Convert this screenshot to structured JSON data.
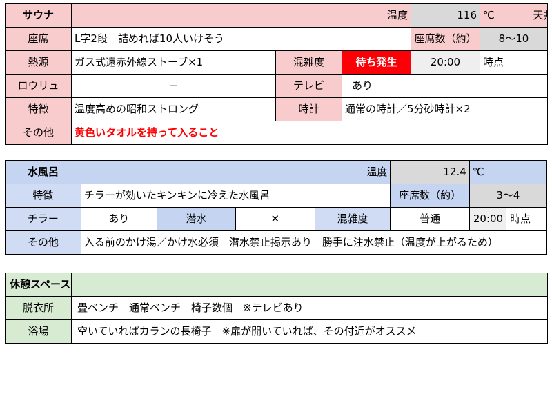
{
  "colors": {
    "sauna_accent": "#f8cbcc",
    "mizuburo_accent": "#c5d4f0",
    "rest_accent": "#d7ebd2",
    "alert_bg": "#fb0007",
    "alert_text": "#ff0000",
    "value_bg": "#d9d9d9",
    "time_bg": "#efefef"
  },
  "sauna": {
    "title": "サウナ",
    "temp_label": "温度",
    "temp_value": "116",
    "temp_unit": "℃",
    "temp_note": "天井付近",
    "rows": {
      "seat": {
        "label": "座席",
        "value": "L字2段　詰めれば10人いけそう",
        "count_label": "座席数（約）",
        "count_value": "8〜10"
      },
      "heat": {
        "label": "熱源",
        "value": "ガス式遠赤外線ストーブ×1",
        "crowd_label": "混雑度",
        "crowd_value": "待ち発生",
        "crowd_time": "20:00",
        "crowd_time_suffix": "時点"
      },
      "loyly": {
        "label": "ロウリュ",
        "value": "−",
        "tv_label": "テレビ",
        "tv_value": "あり"
      },
      "feature": {
        "label": "特徴",
        "value": "温度高めの昭和ストロング",
        "clock_label": "時計",
        "clock_value": "通常の時計／5分砂時計×2"
      },
      "other": {
        "label": "その他",
        "value": "黄色いタオルを持って入ること"
      }
    }
  },
  "mizuburo": {
    "title": "水風呂",
    "temp_label": "温度",
    "temp_value": "12.4",
    "temp_unit": "℃",
    "rows": {
      "feature": {
        "label": "特徴",
        "value": "チラーが効いたキンキンに冷えた水風呂",
        "count_label": "座席数（約）",
        "count_value": "3〜4"
      },
      "chiller": {
        "label": "チラー",
        "value": "あり",
        "dive_label": "潜水",
        "dive_value": "✕",
        "crowd_label": "混雑度",
        "crowd_value": "普通",
        "crowd_time": "20:00",
        "crowd_time_suffix": "時点"
      },
      "other": {
        "label": "その他",
        "value": "入る前のかけ湯／かけ水必須　潜水禁止掲示あり　勝手に注水禁止（温度が上がるため）"
      }
    }
  },
  "rest": {
    "title": "休憩スペース",
    "rows": [
      {
        "label": "脱衣所",
        "value": "畳ベンチ　通常ベンチ　椅子数個　※テレビあり"
      },
      {
        "label": "浴場",
        "value": "空いていればカランの長椅子　※扉が開いていれば、その付近がオススメ"
      }
    ]
  }
}
